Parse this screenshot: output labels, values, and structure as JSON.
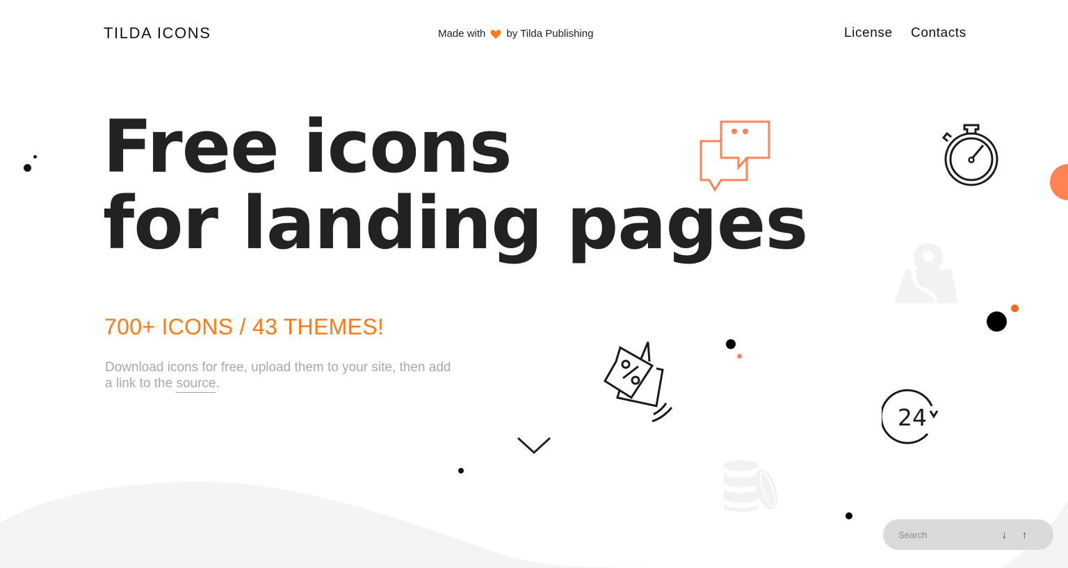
{
  "header": {
    "logo": "TILDA ICONS",
    "made_with_prefix": "Made with",
    "made_with_suffix": "by Tilda Publishing",
    "nav": [
      {
        "label": "License"
      },
      {
        "label": "Contacts"
      }
    ]
  },
  "hero": {
    "title_line1": "Free icons",
    "title_line2": "for landing pages",
    "counts": "700+ ICONS / 43 THEMES!",
    "desc_before_link": "Download icons for free, upload them to your site, then add a link to the ",
    "desc_link": "source",
    "desc_after_link": "."
  },
  "decorative_icons": [
    {
      "name": "chat-bubbles-icon",
      "color": "#ff8355"
    },
    {
      "name": "stopwatch-icon",
      "color": "#1a1a1a"
    },
    {
      "name": "map-pin-icon",
      "color": "#f2f2f2"
    },
    {
      "name": "discount-tag-icon",
      "color": "#1a1a1a"
    },
    {
      "name": "24-hours-icon",
      "color": "#1a1a1a",
      "label": "24"
    },
    {
      "name": "coins-stack-icon",
      "color": "#f2f2f2"
    }
  ],
  "search": {
    "placeholder": "Search",
    "value": "",
    "down_arrow": "↓",
    "up_arrow": "↑"
  },
  "colors": {
    "accent": "#ff7a1a",
    "accent_soft": "#ff8355",
    "text": "#222222",
    "muted": "#a8a8a8",
    "wave": "#f4f4f4"
  }
}
